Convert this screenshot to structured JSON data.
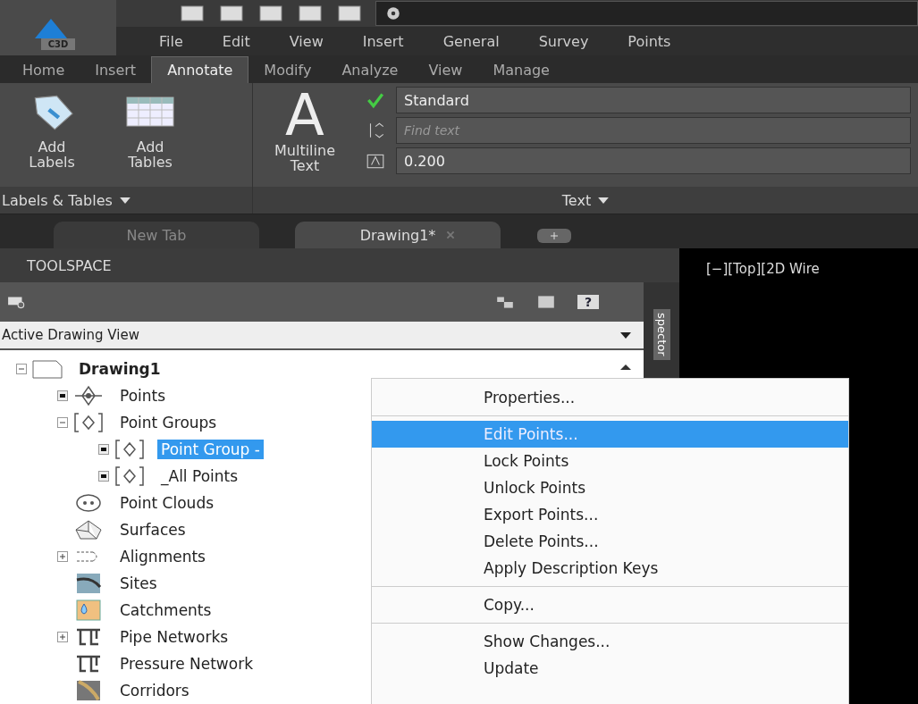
{
  "app_button": {
    "label": "C3D"
  },
  "menu_bar": [
    "File",
    "Edit",
    "View",
    "Insert",
    "General",
    "Survey",
    "Points"
  ],
  "ribbon_tabs": [
    {
      "label": "Home",
      "selected": false
    },
    {
      "label": "Insert",
      "selected": false
    },
    {
      "label": "Annotate",
      "selected": true
    },
    {
      "label": "Modify",
      "selected": false
    },
    {
      "label": "Analyze",
      "selected": false
    },
    {
      "label": "View",
      "selected": false
    },
    {
      "label": "Manage",
      "selected": false
    }
  ],
  "ribbon_panels": [
    {
      "title": "Labels & Tables",
      "buttons": [
        {
          "kind": "labels",
          "lines": [
            "Add",
            "Labels"
          ]
        },
        {
          "kind": "tables",
          "lines": [
            "Add",
            "Tables"
          ]
        }
      ]
    },
    {
      "title": "Text",
      "buttons": [
        {
          "kind": "multiline",
          "glyph": "A",
          "lines": [
            "Multiline",
            "Text"
          ]
        }
      ],
      "fields": [
        {
          "kind": "style",
          "value": "Standard"
        },
        {
          "kind": "find",
          "placeholder": "Find text"
        },
        {
          "kind": "height",
          "value": "0.200"
        }
      ]
    }
  ],
  "doc_tabs": [
    {
      "label": "New Tab",
      "selected": false
    },
    {
      "label": "Drawing1*",
      "selected": true
    }
  ],
  "toolspace": {
    "title": "TOOLSPACE",
    "view_select": "Active Drawing View",
    "side_tab": "spector",
    "help_button": "?",
    "tree": [
      {
        "label": "Drawing1",
        "kind": "drawing",
        "expanded": true,
        "selected": false,
        "children": [
          {
            "label": "Points",
            "kind": "point",
            "selected": false
          },
          {
            "label": "Point Groups",
            "kind": "group",
            "expanded": true,
            "selected": false,
            "children": [
              {
                "label": "Point Group -",
                "kind": "group",
                "selected": true
              },
              {
                "label": "_All Points",
                "kind": "group",
                "selected": false
              }
            ]
          },
          {
            "label": "Point Clouds",
            "kind": "cloud",
            "selected": false
          },
          {
            "label": "Surfaces",
            "kind": "surface",
            "selected": false
          },
          {
            "label": "Alignments",
            "kind": "alignment",
            "expanded": false,
            "selected": false
          },
          {
            "label": "Sites",
            "kind": "site",
            "selected": false
          },
          {
            "label": "Catchments",
            "kind": "catchment",
            "selected": false
          },
          {
            "label": "Pipe Networks",
            "kind": "pipe",
            "expanded": false,
            "selected": false
          },
          {
            "label": "Pressure Network",
            "kind": "pipe",
            "selected": false
          },
          {
            "label": "Corridors",
            "kind": "corridor",
            "selected": false
          }
        ]
      }
    ]
  },
  "viewport": {
    "label": "[−][Top][2D Wire"
  },
  "context_menu": [
    [
      {
        "label": "Properties...",
        "selected": false
      }
    ],
    [
      {
        "label": "Edit Points...",
        "selected": true
      },
      {
        "label": "Lock Points",
        "selected": false
      },
      {
        "label": "Unlock Points",
        "selected": false
      },
      {
        "label": "Export Points...",
        "selected": false
      },
      {
        "label": "Delete Points...",
        "selected": false
      },
      {
        "label": "Apply Description Keys",
        "selected": false
      }
    ],
    [
      {
        "label": "Copy...",
        "selected": false
      }
    ],
    [
      {
        "label": "Show Changes...",
        "selected": false
      },
      {
        "label": "Update",
        "selected": false
      }
    ]
  ]
}
